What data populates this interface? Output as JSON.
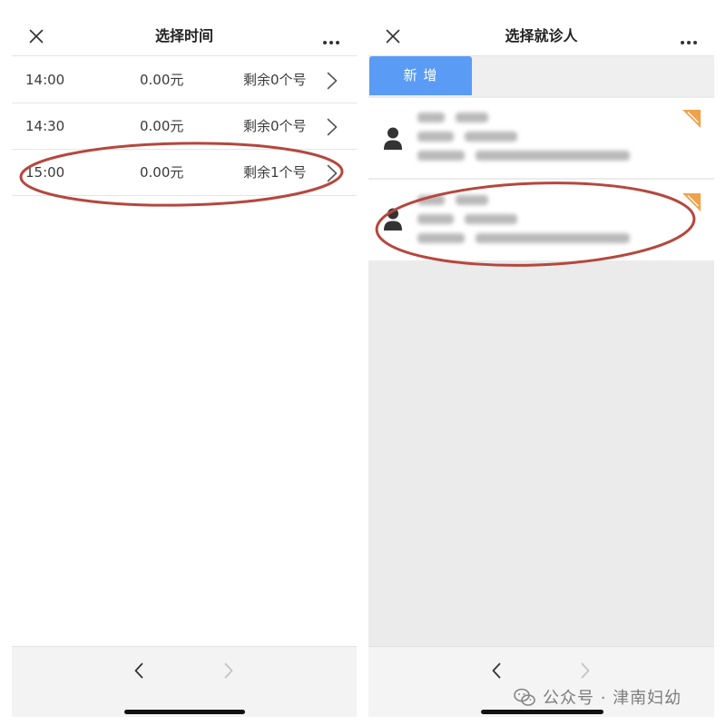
{
  "colors": {
    "accent_blue": "#5a9cf5",
    "annotation_red": "#b5473d",
    "tag_orange": "#f0a24a"
  },
  "time_screen": {
    "header": {
      "title": "选择时间",
      "close_icon": "close-icon",
      "more_icon": "more-icon"
    },
    "time_slots": [
      {
        "time": "14:00",
        "price": "0.00元",
        "remaining": "剩余0个号",
        "circled": false
      },
      {
        "time": "14:30",
        "price": "0.00元",
        "remaining": "剩余0个号",
        "circled": false
      },
      {
        "time": "15:00",
        "price": "0.00元",
        "remaining": "剩余1个号",
        "circled": true
      }
    ],
    "bottom_nav": {
      "back_icon": "chevron-left-icon",
      "forward_icon": "chevron-right-icon",
      "back_enabled": true,
      "forward_enabled": false
    }
  },
  "patient_screen": {
    "header": {
      "title": "选择就诊人",
      "close_icon": "close-icon",
      "more_icon": "more-icon"
    },
    "add_button": {
      "label": "新 增"
    },
    "patients": [
      {
        "avatar_icon": "person-icon",
        "tag_icon": "corner-tag-icon",
        "circled": false
      },
      {
        "avatar_icon": "person-icon",
        "tag_icon": "corner-tag-icon",
        "circled": true
      }
    ],
    "bottom_nav": {
      "back_icon": "chevron-left-icon",
      "forward_icon": "chevron-right-icon",
      "back_enabled": true,
      "forward_enabled": false
    }
  },
  "watermark": {
    "icon": "wechat-icon",
    "text": "公众号 · 津南妇幼"
  }
}
